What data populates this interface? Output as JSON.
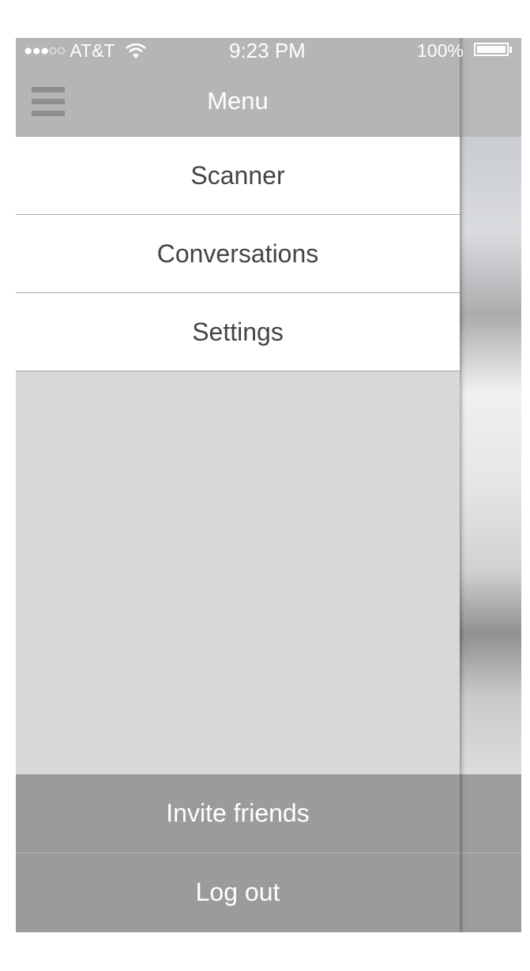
{
  "status_bar": {
    "signal_dots": "●●●○○",
    "carrier": "AT&T",
    "time": "9:23 PM",
    "battery_percent": "100%"
  },
  "nav": {
    "title": "Menu",
    "menu_icon": "hamburger-menu-icon"
  },
  "menu": {
    "items": [
      {
        "label": "Scanner"
      },
      {
        "label": "Conversations"
      },
      {
        "label": "Settings"
      }
    ]
  },
  "footer": {
    "invite_label": "Invite friends",
    "logout_label": "Log out"
  },
  "colors": {
    "nav_bar": "#b5b5b5",
    "drawer_background": "#d8d8d8",
    "footer_background": "#9b9b9b",
    "menu_text": "#444444"
  }
}
